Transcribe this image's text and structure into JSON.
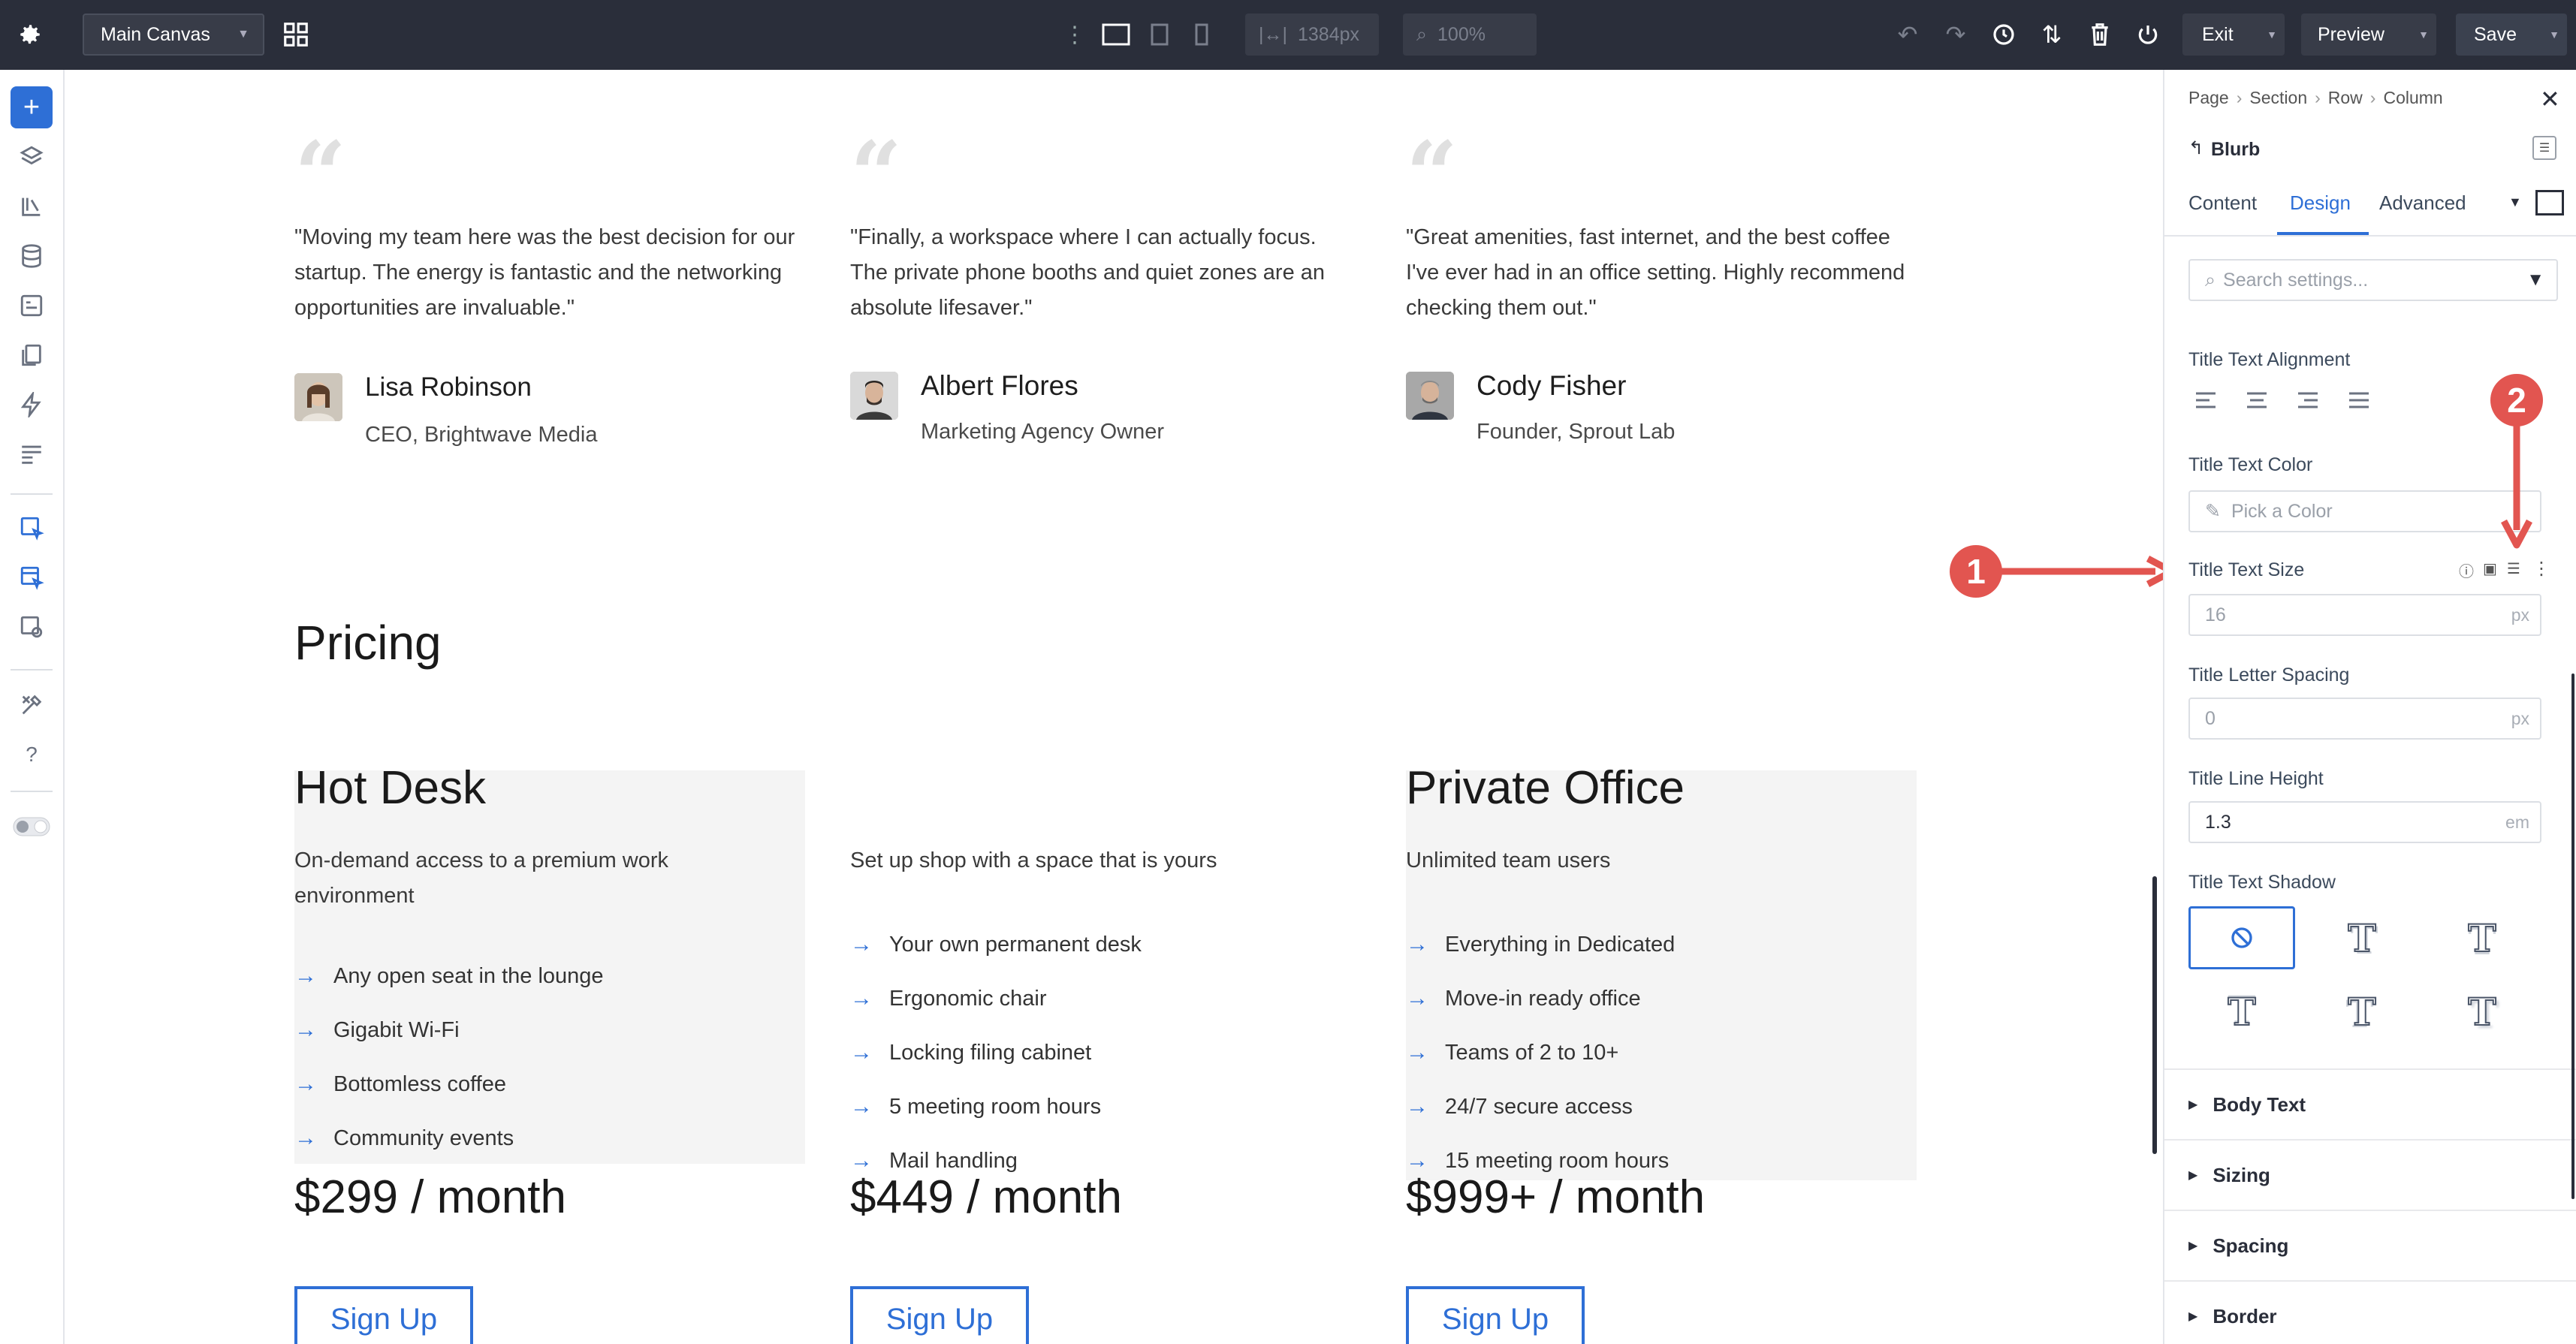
{
  "topbar": {
    "canvas_select": "Main Canvas",
    "width_value": "1384px",
    "zoom_value": "100%",
    "exit_label": "Exit",
    "preview_label": "Preview",
    "save_label": "Save"
  },
  "testimonials": [
    {
      "quote": "\"Moving my team here was the best decision for our startup. The energy is fantastic and the networking opportunities are invaluable.\"",
      "name": "Lisa Robinson",
      "role": "CEO, Brightwave Media"
    },
    {
      "quote": "\"Finally, a workspace where I can actually focus. The private phone booths and quiet zones are an absolute lifesaver.\"",
      "name": "Albert Flores",
      "role": "Marketing Agency Owner"
    },
    {
      "quote": "\"Great amenities, fast internet, and the best coffee I've ever had in an office setting. Highly recommend checking them out.\"",
      "name": "Cody Fisher",
      "role": "Founder, Sprout Lab"
    }
  ],
  "pricing": {
    "heading": "Pricing",
    "plans": [
      {
        "title": "Hot Desk",
        "desc": "On-demand access to a premium work environment",
        "features": [
          "Any open seat in the lounge",
          "Gigabit Wi-Fi",
          "Bottomless coffee",
          "Community events"
        ],
        "price": "$299 / month",
        "cta": "Sign Up"
      },
      {
        "title": "",
        "desc": "Set up shop with a space that is yours",
        "features": [
          "Your own permanent desk",
          "Ergonomic chair",
          "Locking filing cabinet",
          "5 meeting room hours",
          "Mail handling"
        ],
        "price": "$449 / month",
        "cta": "Sign Up"
      },
      {
        "title": "Private Office",
        "desc": "Unlimited team users",
        "features": [
          "Everything in Dedicated",
          "Move-in ready office",
          "Teams of 2 to 10+",
          "24/7 secure access",
          "15 meeting room hours"
        ],
        "price": "$999+ / month",
        "cta": "Sign Up"
      }
    ]
  },
  "panel": {
    "breadcrumb": [
      "Page",
      "Section",
      "Row",
      "Column"
    ],
    "module": "Blurb",
    "tabs": [
      "Content",
      "Design",
      "Advanced"
    ],
    "active_tab": "Design",
    "search_placeholder": "Search settings...",
    "title_text_alignment": "Title Text Alignment",
    "title_text_color": "Title Text Color",
    "color_placeholder": "Pick a Color",
    "title_text_size": "Title Text Size",
    "size_value": "16",
    "size_unit": "px",
    "title_letter_spacing": "Title Letter Spacing",
    "letter_value": "0",
    "letter_unit": "px",
    "title_line_height": "Title Line Height",
    "line_value": "1.3",
    "line_unit": "em",
    "title_text_shadow": "Title Text Shadow",
    "sections": [
      "Body Text",
      "Sizing",
      "Spacing",
      "Border"
    ]
  },
  "annotations": {
    "one": "1",
    "two": "2"
  },
  "colors": {
    "accent": "#2e6fd6",
    "topbar": "#2a2e3a",
    "annotation": "#e25550"
  }
}
